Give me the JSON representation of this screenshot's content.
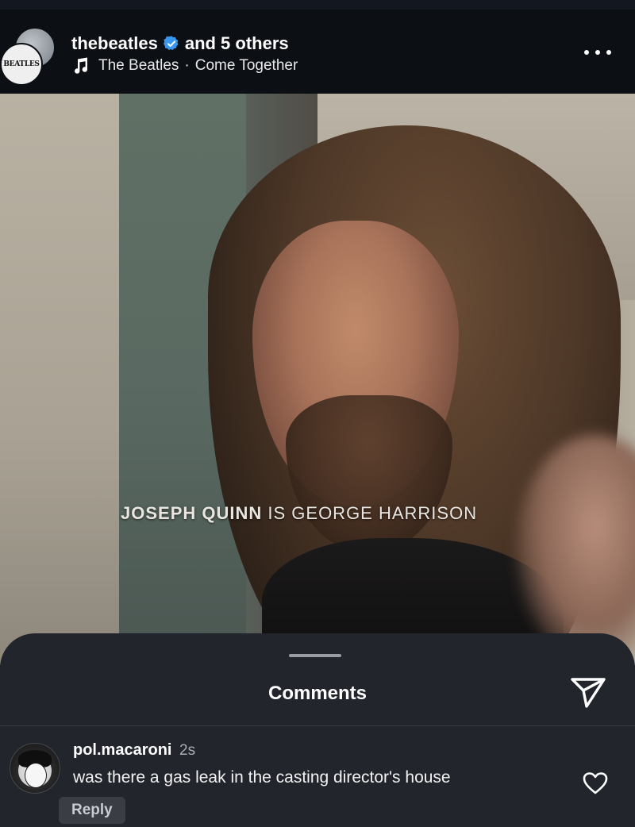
{
  "header": {
    "username": "thebeatles",
    "collaborators": "and 5 others",
    "avatar_text": "BEATLES",
    "audio_artist": "The Beatles",
    "audio_separator": "·",
    "audio_track": "Come Together"
  },
  "video": {
    "caption_name": "JOSEPH QUINN",
    "caption_rest": " IS GEORGE HARRISON"
  },
  "comments_sheet": {
    "title": "Comments",
    "comments": [
      {
        "username": "pol.macaroni",
        "time": "2s",
        "text": "was there a gas leak in the casting director's house",
        "reply_label": "Reply"
      }
    ]
  },
  "colors": {
    "verified_badge": "#3897f0",
    "sheet_background": "#22252c",
    "header_background": "#0c0f14"
  },
  "icons": {
    "verified": "verified-badge-icon",
    "music": "music-note-icon",
    "more": "more-dots-icon",
    "share": "paper-plane-icon",
    "like": "heart-outline-icon"
  }
}
